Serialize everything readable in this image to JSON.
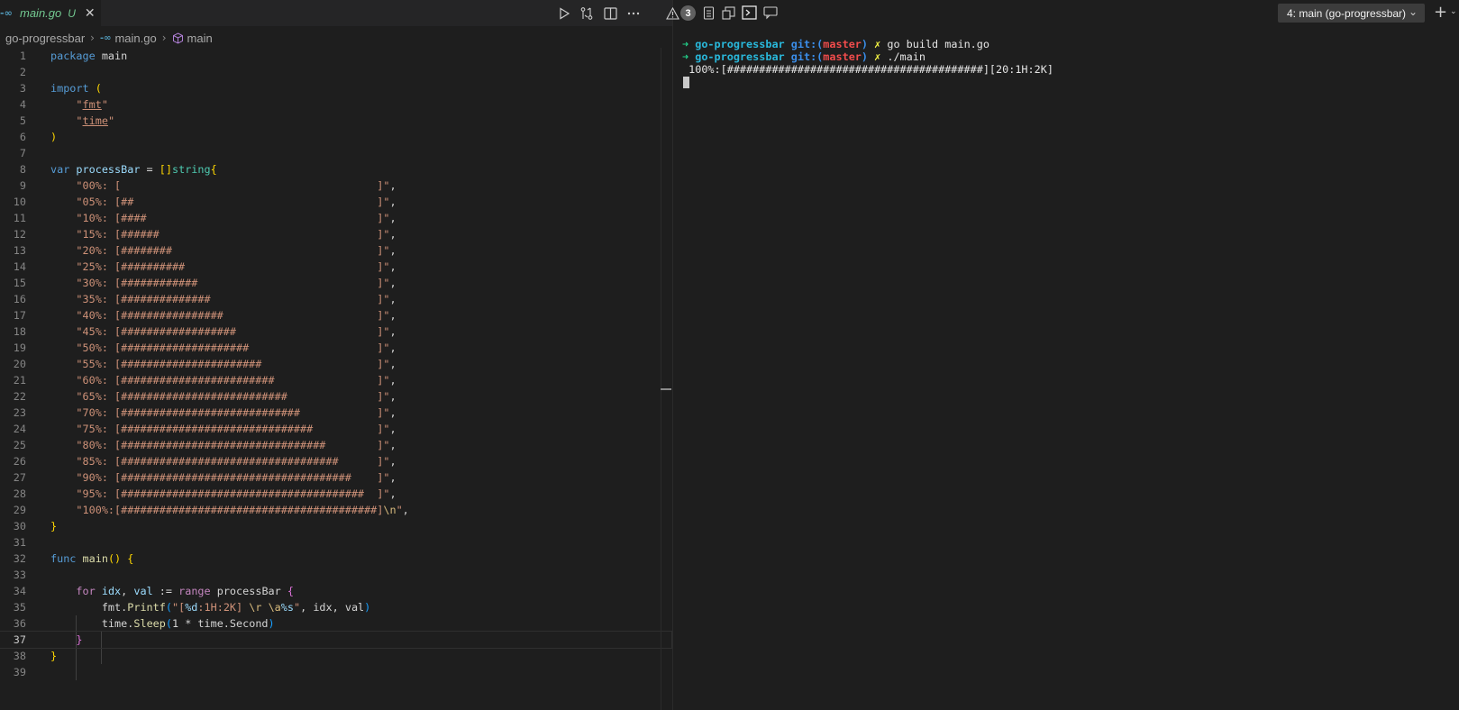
{
  "editor": {
    "tab": {
      "icon": "go-file-icon",
      "filename": "main.go",
      "status": "U"
    },
    "actions": [
      "run-icon",
      "compare-changes-icon",
      "split-editor-icon",
      "more-actions-icon"
    ],
    "breadcrumb": {
      "folder": "go-progressbar",
      "file": "main.go",
      "symbol": "main"
    },
    "current_line": 37,
    "line_numbers": [
      "1",
      "2",
      "3",
      "4",
      "5",
      "6",
      "7",
      "8",
      "9",
      "10",
      "11",
      "12",
      "13",
      "14",
      "15",
      "16",
      "17",
      "18",
      "19",
      "20",
      "21",
      "22",
      "23",
      "24",
      "25",
      "26",
      "27",
      "28",
      "29",
      "30",
      "31",
      "32",
      "33",
      "34",
      "35",
      "36",
      "37",
      "38",
      "39"
    ],
    "code": {
      "l1_kw": "package",
      "l1_name": " main",
      "l3_kw": "import",
      "l3_paren": " (",
      "l4_q1": "\"",
      "l4_pkg": "fmt",
      "l4_q2": "\"",
      "l5_q1": "\"",
      "l5_pkg": "time",
      "l5_q2": "\"",
      "l6_paren": ")",
      "l8_kw": "var",
      "l8_name": " processBar",
      "l8_eq": " = ",
      "l8_br": "[]",
      "l8_type": "string",
      "l8_brace": "{",
      "bars": [
        "\"00%: [                                        ]\"",
        "\"05%: [##                                      ]\"",
        "\"10%: [####                                    ]\"",
        "\"15%: [######                                  ]\"",
        "\"20%: [########                                ]\"",
        "\"25%: [##########                              ]\"",
        "\"30%: [############                            ]\"",
        "\"35%: [##############                          ]\"",
        "\"40%: [################                        ]\"",
        "\"45%: [##################                      ]\"",
        "\"50%: [####################                    ]\"",
        "\"55%: [######################                  ]\"",
        "\"60%: [########################                ]\"",
        "\"65%: [##########################              ]\"",
        "\"70%: [############################            ]\"",
        "\"75%: [##############################          ]\"",
        "\"80%: [################################        ]\"",
        "\"85%: [##################################      ]\"",
        "\"90%: [####################################    ]\"",
        "\"95%: [######################################  ]\""
      ],
      "l29_str": "\"100%:[########################################]",
      "l29_esc": "\\n",
      "l29_q": "\"",
      "comma": ",",
      "l30_brace": "}",
      "l32_kw": "func",
      "l32_fn": " main",
      "l32_paren": "()",
      "l32_brace": " {",
      "l34_kw": "for",
      "l34_a": " idx",
      "l34_c": ", ",
      "l34_b": "val",
      "l34_op": " := ",
      "l34_range": "range",
      "l34_name": " processBar",
      "l34_brace": " {",
      "l35_pkg": "fmt",
      "l35_dot": ".",
      "l35_fn": "Printf",
      "l35_p": "(",
      "l35_s1": "\"[",
      "l35_f1": "%d",
      "l35_s2": ":1H:2K] ",
      "l35_e1": "\\r",
      "l35_s3": " ",
      "l35_e2": "\\a",
      "l35_f2": "%s",
      "l35_s4": "\"",
      "l35_args": ", idx, val",
      "l35_cp": ")",
      "l36_pkg": "time",
      "l36_dot": ".",
      "l36_fn": "Sleep",
      "l36_p": "(",
      "l36_args": "1 * time.Second",
      "l36_cp": ")",
      "l37_brace": "}",
      "l38_brace": "}"
    }
  },
  "terminal": {
    "problems_count": "3",
    "icons": [
      "warning-icon",
      "output-icon",
      "debug-console-icon",
      "terminal-icon",
      "comments-icon"
    ],
    "selected_terminal": "4: main (go-progressbar)",
    "lines": [
      {
        "arrow": "➜",
        "dir": "go-progressbar",
        "git": "git:(",
        "branch": "master",
        "git_close": ")",
        "dirty": "✗",
        "cmd": "go build main.go"
      },
      {
        "arrow": "➜",
        "dir": "go-progressbar",
        "git": "git:(",
        "branch": "master",
        "git_close": ")",
        "dirty": "✗",
        "cmd": "./main"
      }
    ],
    "output": "100%:[########################################][20:1H:2K]"
  }
}
